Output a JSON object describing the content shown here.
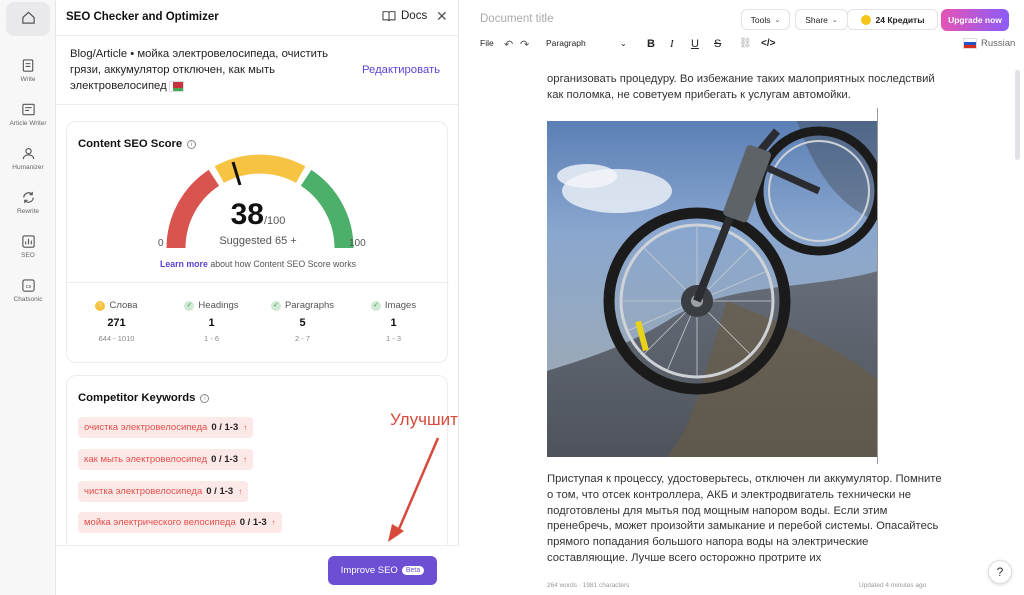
{
  "rail": {
    "items": [
      {
        "label": ""
      },
      {
        "label": "Write"
      },
      {
        "label": "Article Writer"
      },
      {
        "label": "Humanizer"
      },
      {
        "label": "Rewrite"
      },
      {
        "label": "SEO"
      },
      {
        "label": "Chatsonic"
      }
    ]
  },
  "panel": {
    "title": "SEO Checker and Optimizer",
    "docs_label": "Docs",
    "topic_text": "Blog/Article • мойка электровелосипеда, очистить грязи, аккумулятор отключен, как мыть электровелосипед",
    "edit_label": "Редактировать"
  },
  "score": {
    "title": "Content SEO Score",
    "value": "38",
    "max": "/100",
    "suggested": "Suggested  65 +",
    "min_label": "0",
    "max_label": "100",
    "learn_link": "Learn more",
    "learn_rest": " about how Content SEO Score works",
    "stats": [
      {
        "label": "Слова",
        "value": "271",
        "range": "644 - 1010",
        "status": "warning"
      },
      {
        "label": "Headings",
        "value": "1",
        "range": "1 - 6",
        "status": "ok"
      },
      {
        "label": "Paragraphs",
        "value": "5",
        "range": "2 - 7",
        "status": "ok"
      },
      {
        "label": "Images",
        "value": "1",
        "range": "1 - 3",
        "status": "ok"
      }
    ]
  },
  "keywords": {
    "title": "Competitor Keywords",
    "items": [
      {
        "text": "очистка электровелосипеда",
        "count": "0 / 1-3"
      },
      {
        "text": "как мыть электровелосипед",
        "count": "0 / 1-3"
      },
      {
        "text": "чистка электровелосипеда",
        "count": "0 / 1-3"
      },
      {
        "text": "мойка электрического велосипеда",
        "count": "0 / 1-3"
      }
    ]
  },
  "footer": {
    "improve_label": "Improve SEO",
    "beta_label": "Beta"
  },
  "annotation": "Улучшить SEO",
  "editor": {
    "doc_title_placeholder": "Document title",
    "tools_label": "Tools",
    "share_label": "Share",
    "credits_label": "24 Кредиты",
    "upgrade_label": "Upgrade now",
    "toolbar": {
      "file": "File",
      "paragraph": "Paragraph",
      "language": "Russian"
    },
    "para1": "организовать процедуру. Во избежание таких малоприятных последствий как поломка, не советуем прибегать к услугам автомойки.",
    "para2": "Приступая к процессу, удостоверьтесь, отключен ли аккумулятор. Помните о том, что отсек контроллера, АКБ и электродвигатель технически не подготовлены для мытья под мощным напором воды. Если этим пренебречь, может произойти замыкание и перебой системы. Опасайтесь прямого попадания большого напора воды на электрические составляющие. Лучше всего осторожно протрите их",
    "word_count": "264 words",
    "char_count": "1981 characters",
    "updated": "Updated 4 minutes ago"
  },
  "colors": {
    "accent": "#6c4fd3",
    "gauge_red": "#d9534f",
    "gauge_yellow": "#f6c342",
    "gauge_green": "#4caf6a"
  }
}
